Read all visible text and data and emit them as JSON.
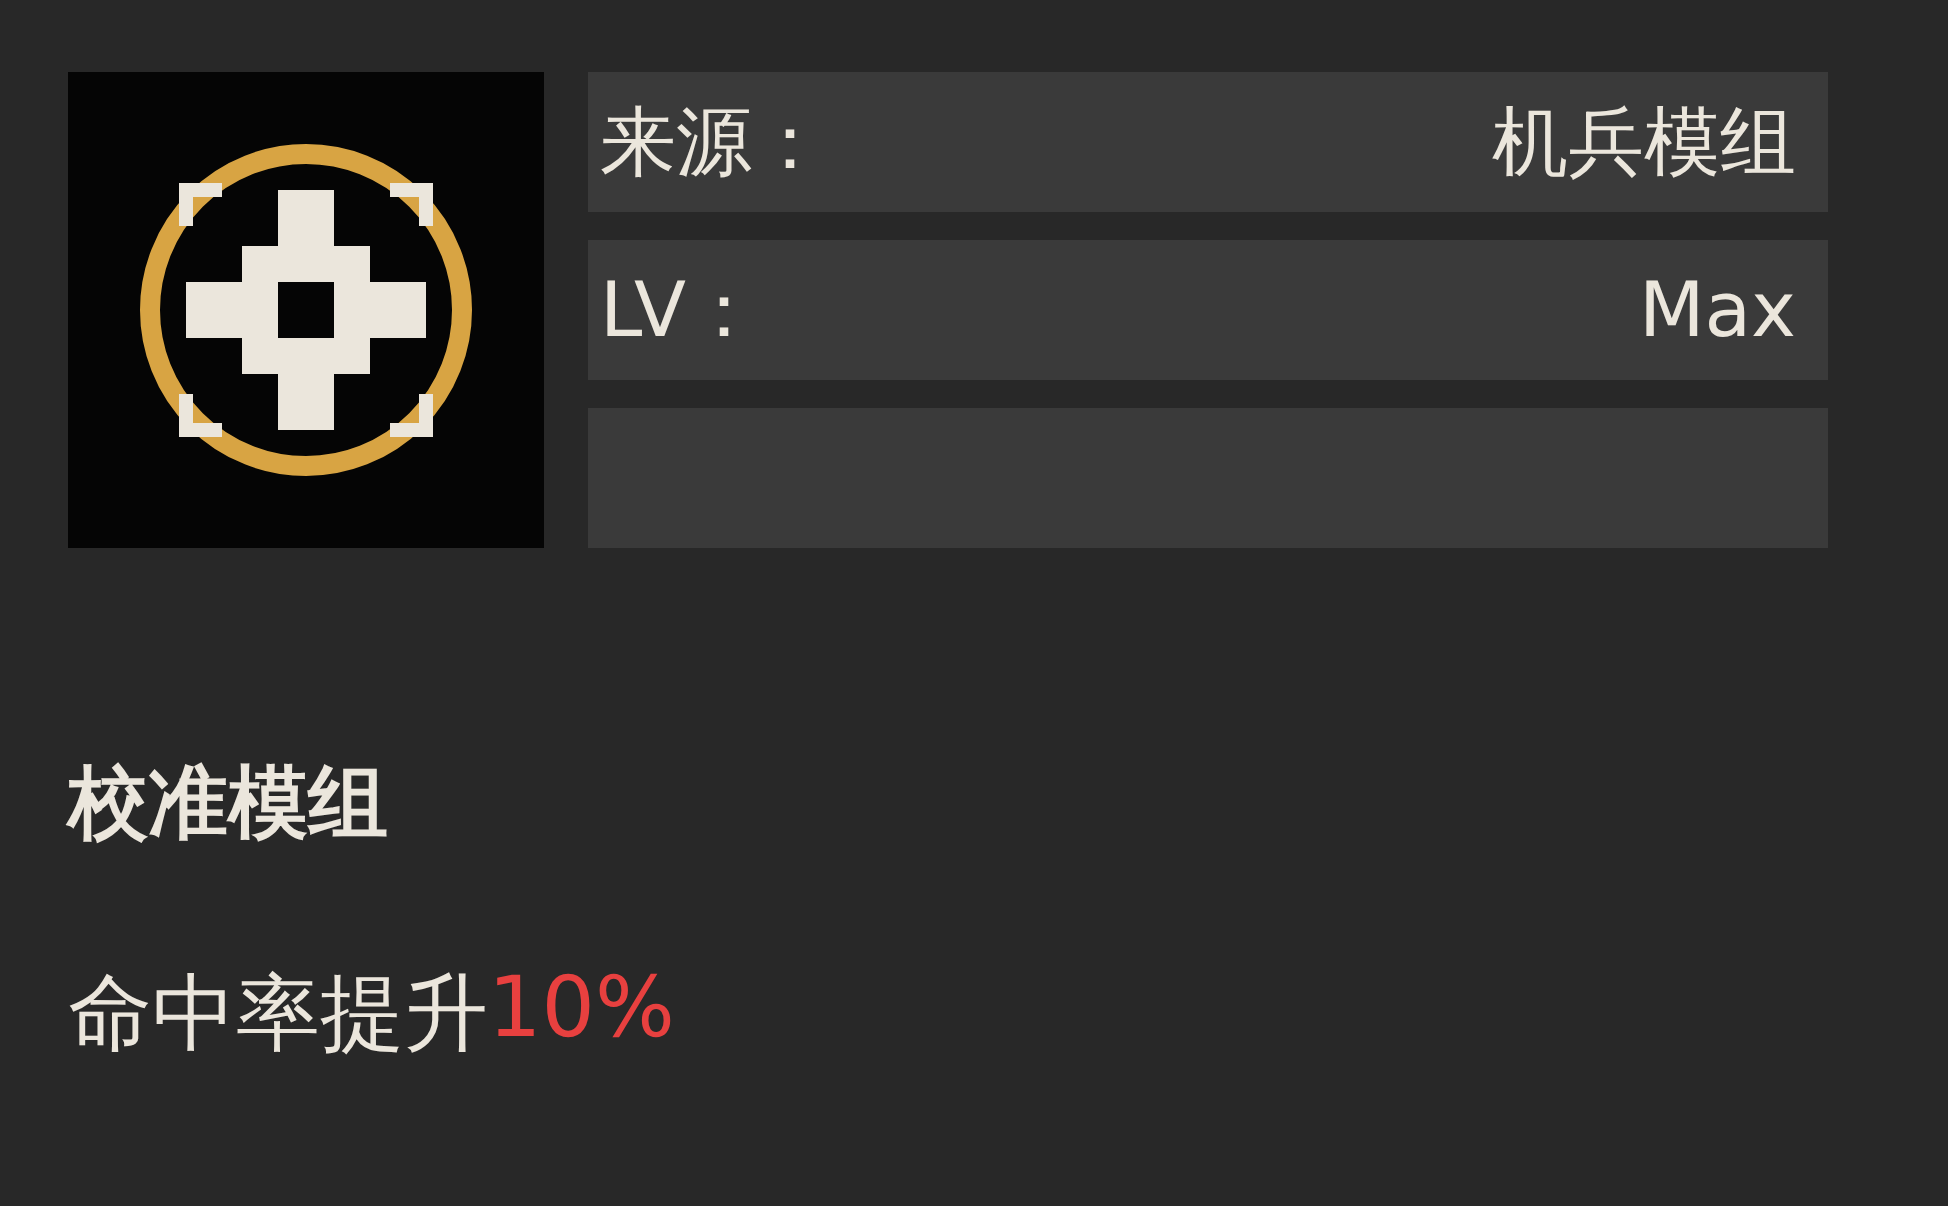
{
  "info_rows": [
    {
      "label": "来源：",
      "value": "机兵模组"
    },
    {
      "label": "LV：",
      "value": "Max"
    },
    {}
  ],
  "title": "校准模组",
  "description": {
    "text": "命中率提升",
    "value": "10%"
  }
}
